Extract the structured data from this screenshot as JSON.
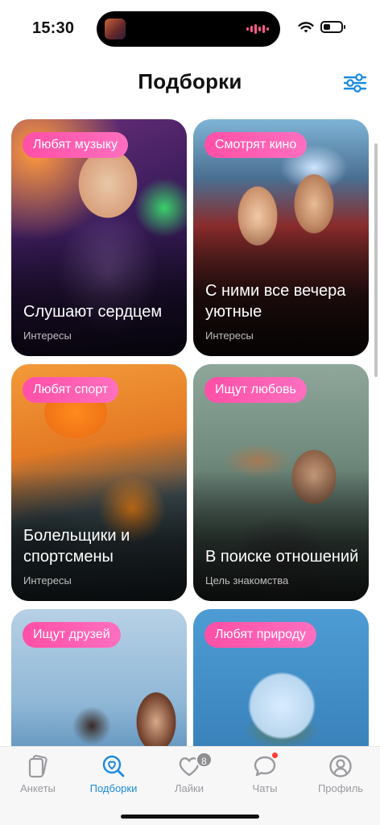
{
  "status_bar": {
    "time": "15:30"
  },
  "header": {
    "title": "Подборки",
    "filter_icon": "sliders-icon"
  },
  "cards": [
    {
      "tag": "Любят музыку",
      "title": "Слушают сердцем",
      "subtitle": "Интересы"
    },
    {
      "tag": "Смотрят кино",
      "title": "С ними все вечера уютные",
      "subtitle": "Интересы"
    },
    {
      "tag": "Любят спорт",
      "title": "Болельщики и спортсмены",
      "subtitle": "Интересы"
    },
    {
      "tag": "Ищут любовь",
      "title": "В поиске отношений",
      "subtitle": "Цель знакомства"
    },
    {
      "tag": "Ищут друзей",
      "title": "",
      "subtitle": ""
    },
    {
      "tag": "Любят природу",
      "title": "",
      "subtitle": ""
    }
  ],
  "tab_bar": {
    "items": [
      {
        "label": "Анкеты",
        "icon": "cards-icon",
        "active": false
      },
      {
        "label": "Подборки",
        "icon": "heart-search-icon",
        "active": true
      },
      {
        "label": "Лайки",
        "icon": "heart-icon",
        "active": false,
        "badge": "8"
      },
      {
        "label": "Чаты",
        "icon": "chat-bubble-icon",
        "active": false,
        "unread_dot": true
      },
      {
        "label": "Профиль",
        "icon": "profile-icon",
        "active": false
      }
    ]
  },
  "colors": {
    "accent": "#1b8ae0",
    "tag_pink": "#ff4fa6",
    "inactive": "#9a9a9f"
  }
}
